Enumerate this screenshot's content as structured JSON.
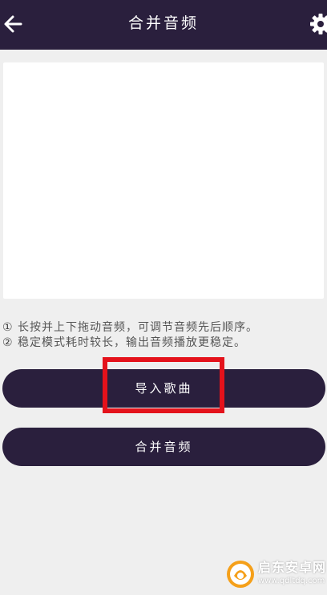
{
  "header": {
    "title": "合并音频",
    "back_icon": "arrow-left-icon",
    "settings_icon": "gear-icon"
  },
  "tips": {
    "line1_num": "①",
    "line1_text": " 长按并上下拖动音频，可调节音频先后顺序。",
    "line2_num": "②",
    "line2_text": " 稳定模式耗时较长，输出音频播放更稳定。"
  },
  "actions": {
    "import_label": "导入歌曲",
    "merge_label": "合并音频"
  },
  "watermark": {
    "name": "启东安卓网",
    "url": "www.qdltdq.com"
  },
  "colors": {
    "primary": "#2a1f3d",
    "background": "#efefef",
    "highlight": "#e4121b",
    "watermark_logo": "#f5a01a"
  }
}
